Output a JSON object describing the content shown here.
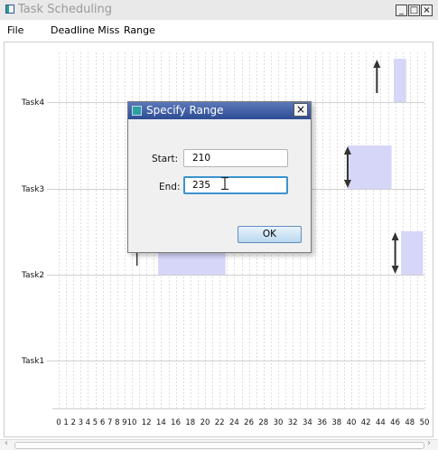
{
  "window": {
    "title": "Task Scheduling",
    "buttons": {
      "minimize": "_",
      "maximize": "□",
      "close": "×"
    }
  },
  "menu": {
    "items": [
      "File",
      "Deadline Miss",
      "Range"
    ]
  },
  "chart": {
    "tasks": [
      "Task4",
      "Task3",
      "Task2",
      "Task1"
    ],
    "x_labels": [
      "0",
      "1",
      "2",
      "3",
      "4",
      "5",
      "6",
      "7",
      "8",
      "9",
      "10",
      "12",
      "14",
      "16",
      "18",
      "20",
      "22",
      "24",
      "26",
      "28",
      "30",
      "32",
      "34",
      "36",
      "38",
      "40",
      "42",
      "44",
      "46",
      "48",
      "50"
    ],
    "colors": {
      "execution": "#d6d6f8",
      "arrow": "#333333",
      "grid": "#c8c8c8"
    }
  },
  "chart_data": {
    "type": "gantt",
    "categories": [
      "Task4",
      "Task3",
      "Task2",
      "Task1"
    ],
    "xlim": [
      0,
      50
    ],
    "x_ticks": [
      0,
      1,
      2,
      3,
      4,
      5,
      6,
      7,
      8,
      9,
      10,
      12,
      14,
      16,
      18,
      20,
      22,
      24,
      26,
      28,
      30,
      32,
      34,
      36,
      38,
      40,
      42,
      44,
      46,
      48,
      50
    ],
    "bars": [
      {
        "task": "Task4",
        "start": 45.8,
        "end": 47.5
      },
      {
        "task": "Task3",
        "start": 39.5,
        "end": 45.5
      },
      {
        "task": "Task2",
        "start": 13.6,
        "end": 22.8
      },
      {
        "task": "Task2",
        "start": 46.8,
        "end": 49.8
      }
    ],
    "arrows": [
      {
        "task": "Task4",
        "x": 43.5,
        "direction": "up"
      },
      {
        "task": "Task3",
        "x": 39.5,
        "direction": "both"
      },
      {
        "task": "Task2",
        "x": 46.0,
        "direction": "both"
      },
      {
        "task": "Task2",
        "x": 10.7,
        "direction": "tick"
      }
    ]
  },
  "dialog": {
    "title": "Specify Range",
    "close": "×",
    "start_label": "Start:",
    "start_value": "210",
    "end_label": "End:",
    "end_value": "235",
    "ok_label": "OK"
  },
  "scrollbar": {
    "left_arrow": "‹",
    "right_arrow": "›"
  }
}
